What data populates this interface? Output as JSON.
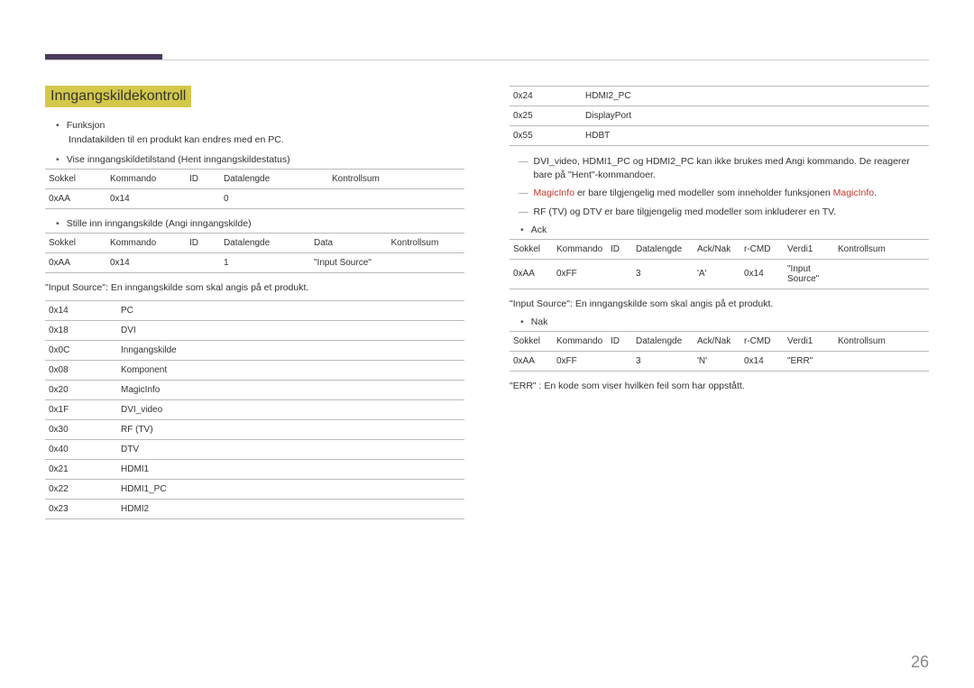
{
  "section_title": "Inngangskildekontroll",
  "bullets": {
    "funksjon": "Funksjon",
    "funksjon_desc": "Inndatakilden til en produkt kan endres med en PC.",
    "vise": "Vise inngangskildetilstand (Hent inngangskildestatus)",
    "stille": "Stille inn inngangskilde (Angi inngangskilde)",
    "ack": "Ack",
    "nak": "Nak"
  },
  "headers": {
    "sokkel": "Sokkel",
    "kommando": "Kommando",
    "id": "ID",
    "datalengde": "Datalengde",
    "kontrollsum": "Kontrollsum",
    "data": "Data",
    "acknak": "Ack/Nak",
    "rcmd": "r-CMD",
    "verdi1": "Verdi1"
  },
  "table1": {
    "sokkel": "0xAA",
    "kommando": "0x14",
    "datalengde": "0"
  },
  "table2": {
    "sokkel": "0xAA",
    "kommando": "0x14",
    "datalengde": "1",
    "data": "\"Input Source\""
  },
  "desc1": "\"Input Source\": En inngangskilde som skal angis på et produkt.",
  "codes_left": [
    {
      "c": "0x14",
      "n": "PC"
    },
    {
      "c": "0x18",
      "n": "DVI"
    },
    {
      "c": "0x0C",
      "n": "Inngangskilde"
    },
    {
      "c": "0x08",
      "n": "Komponent"
    },
    {
      "c": "0x20",
      "n": "MagicInfo"
    },
    {
      "c": "0x1F",
      "n": "DVI_video"
    },
    {
      "c": "0x30",
      "n": "RF (TV)"
    },
    {
      "c": "0x40",
      "n": "DTV"
    },
    {
      "c": "0x21",
      "n": "HDMI1"
    },
    {
      "c": "0x22",
      "n": "HDMI1_PC"
    },
    {
      "c": "0x23",
      "n": "HDMI2"
    }
  ],
  "codes_right": [
    {
      "c": "0x24",
      "n": "HDMI2_PC"
    },
    {
      "c": "0x25",
      "n": "DisplayPort"
    },
    {
      "c": "0x55",
      "n": "HDBT"
    }
  ],
  "notes": {
    "n1": "DVI_video, HDMI1_PC og HDMI2_PC kan ikke brukes med Angi kommando. De reagerer bare på \"Hent\"-kommandoer.",
    "n2a": "MagicInfo",
    "n2b": " er bare tilgjengelig med modeller som inneholder funksjonen ",
    "n2c": "MagicInfo",
    "n2d": ".",
    "n3": "RF (TV) og DTV er bare tilgjengelig med modeller som inkluderer en TV."
  },
  "ack_row": {
    "sokkel": "0xAA",
    "kommando": "0xFF",
    "datalengde": "3",
    "acknak": "'A'",
    "rcmd": "0x14",
    "verdi1": "\"Input Source\""
  },
  "desc2": "\"Input Source\": En inngangskilde som skal angis på et produkt.",
  "nak_row": {
    "sokkel": "0xAA",
    "kommando": "0xFF",
    "datalengde": "3",
    "acknak": "'N'",
    "rcmd": "0x14",
    "verdi1": "\"ERR\""
  },
  "desc3": "\"ERR\" : En kode som viser hvilken feil som har oppstått.",
  "page_number": "26"
}
